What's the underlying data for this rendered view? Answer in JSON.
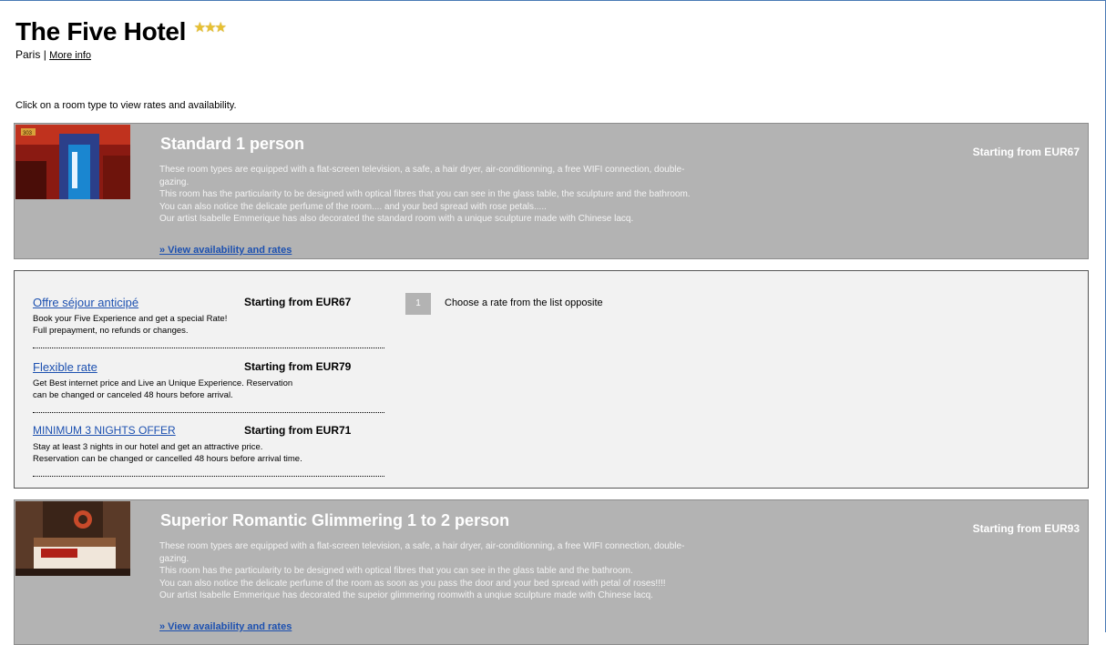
{
  "hotel": {
    "name": "The Five Hotel",
    "stars": "★★★",
    "city": "Paris",
    "separator": "|",
    "more_info": "More info"
  },
  "instructions": "Click on a room type to view rates and availability.",
  "rooms": [
    {
      "name": "Standard 1 person",
      "price": "Starting from EUR67",
      "description_lines": [
        "These room types are equipped with a flat-screen television, a safe, a hair dryer, air-conditionning, a free WIFI connection, double-",
        "gazing.",
        "This room has the particularity to be designed with optical fibres that you can see in the glass table, the sculpture and the bathroom.",
        "You can also notice the delicate perfume of the room.... and your bed spread with rose petals.....",
        "Our artist Isabelle Emmerique has also decorated the standard room with a unique sculpture made with Chinese lacq."
      ],
      "link": "» View availability and rates"
    },
    {
      "name": "Superior Romantic Glimmering 1 to 2 person",
      "price": "Starting from EUR93",
      "description_lines": [
        "These room types are equipped with a flat-screen television, a safe, a hair dryer, air-conditionning, a free WIFI connection, double-",
        "gazing.",
        "This room has the particularity to be designed with optical fibres that you can see in the glass table and the bathroom.",
        "You can also notice the delicate perfume of the room as soon as you pass the door and your bed spread with petal of roses!!!!",
        "Our artist Isabelle Emmerique has decorated the supeior glimmering roomwith a unqiue sculpture made with Chinese lacq."
      ],
      "link": "» View availability and rates"
    }
  ],
  "rates": [
    {
      "name": "Offre séjour anticipé",
      "price": "Starting from EUR67",
      "desc_lines": [
        "Book your Five Experience and get a special Rate!",
        "Full prepayment, no refunds or changes."
      ]
    },
    {
      "name": "Flexible rate",
      "price": "Starting from EUR79",
      "desc_lines": [
        "Get Best internet price and Live an Unique Experience. Reservation",
        "can be changed or canceled 48 hours before arrival."
      ]
    },
    {
      "name": "MINIMUM 3 NIGHTS OFFER",
      "price": "Starting from EUR71",
      "desc_lines": [
        "Stay at least 3 nights in our hotel and get an attractive price.",
        "Reservation can be changed or cancelled 48 hours before arrival time."
      ]
    }
  ],
  "step": {
    "number": "1",
    "text": "Choose a rate from the list opposite"
  },
  "photo_label": "303",
  "colors": {
    "panel_gray": "#b3b3b3",
    "link_blue": "#1c50b0",
    "rates_bg": "#f2f2f2",
    "star_gold": "#e8c030"
  }
}
